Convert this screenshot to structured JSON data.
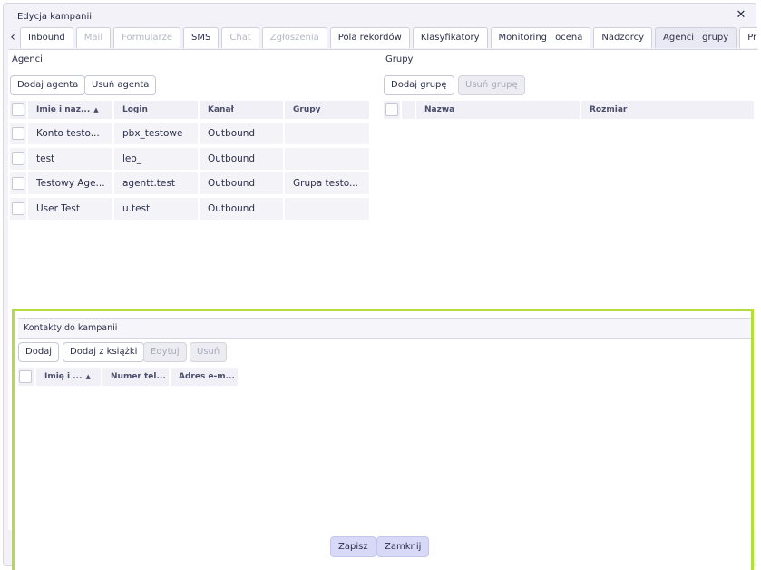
{
  "dialog": {
    "title": "Edycja kampanii",
    "close_icon": "close-icon"
  },
  "tabs": [
    {
      "label": "Inbound",
      "state": "normal"
    },
    {
      "label": "Mail",
      "state": "disabled"
    },
    {
      "label": "Formularze",
      "state": "disabled"
    },
    {
      "label": "SMS",
      "state": "normal"
    },
    {
      "label": "Chat",
      "state": "disabled"
    },
    {
      "label": "Zgłoszenia",
      "state": "disabled"
    },
    {
      "label": "Pola rekordów",
      "state": "normal"
    },
    {
      "label": "Klasyfikatory",
      "state": "normal"
    },
    {
      "label": "Monitoring i ocena",
      "state": "normal"
    },
    {
      "label": "Nadzorcy",
      "state": "normal"
    },
    {
      "label": "Agenci i grupy",
      "state": "active"
    },
    {
      "label": "Priorytety k",
      "state": "normal"
    }
  ],
  "agents": {
    "title": "Agenci",
    "add_label": "Dodaj agenta",
    "remove_label": "Usuń agenta",
    "columns": [
      "Imię i naz...",
      "Login",
      "Kanał",
      "Grupy"
    ],
    "rows": [
      [
        "Konto testo...",
        "pbx_testowe",
        "Outbound",
        ""
      ],
      [
        "test",
        "leo_",
        "Outbound",
        ""
      ],
      [
        "Testowy Age...",
        "agentt.test",
        "Outbound",
        "Grupa testo..."
      ],
      [
        "User Test",
        "u.test",
        "Outbound",
        ""
      ]
    ]
  },
  "groups": {
    "title": "Grupy",
    "add_label": "Dodaj grupę",
    "remove_label": "Usuń grupę",
    "columns": [
      "Nazwa",
      "Rozmiar"
    ]
  },
  "contacts": {
    "title": "Kontakty do kampanii",
    "add_label": "Dodaj",
    "add_book_label": "Dodaj z książki",
    "edit_label": "Edytuj",
    "remove_label": "Usuń",
    "columns": [
      "Imię i ...",
      "Numer tel...",
      "Adres e-m..."
    ],
    "highlight_color": "#b5de3a"
  },
  "footer": {
    "save_label": "Zapisz",
    "close_label": "Zamknij"
  }
}
